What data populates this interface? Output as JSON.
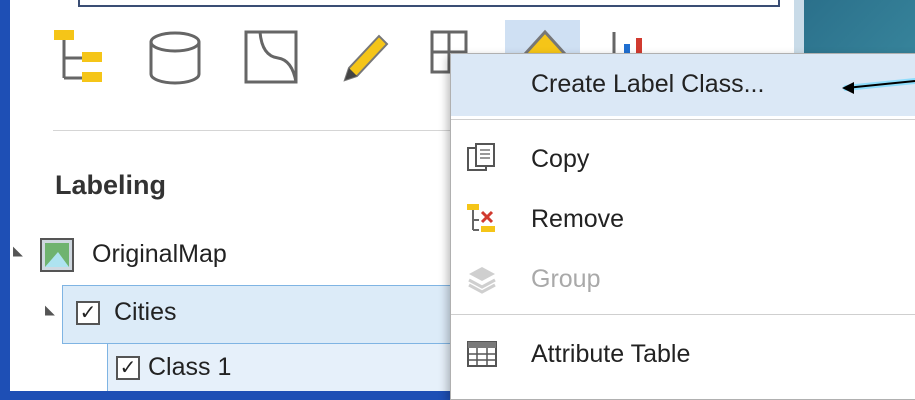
{
  "labeling": {
    "title": "Labeling"
  },
  "tree": {
    "map": "OriginalMap",
    "layer": "Cities",
    "label_class": "Class 1"
  },
  "context_menu": {
    "items": [
      {
        "label": "Create Label Class...",
        "icon": "none",
        "state": "highlighted"
      },
      {
        "label": "Copy",
        "icon": "copy-icon",
        "state": "enabled"
      },
      {
        "label": "Remove",
        "icon": "remove-layer-icon",
        "state": "enabled"
      },
      {
        "label": "Group",
        "icon": "group-layers-icon",
        "state": "disabled"
      },
      {
        "label": "Attribute Table",
        "icon": "table-icon",
        "state": "enabled"
      }
    ]
  },
  "toolbar": {
    "icons": [
      "layer-tree-icon",
      "database-icon",
      "map-icon",
      "pencil-icon",
      "grid-icon",
      "label-icon",
      "chart-icon"
    ]
  },
  "colors": {
    "accent": "#1e4fb5",
    "selection": "#dcebf8",
    "menu_hover": "#dbe8f6",
    "disabled_text": "#a9a9a9"
  }
}
